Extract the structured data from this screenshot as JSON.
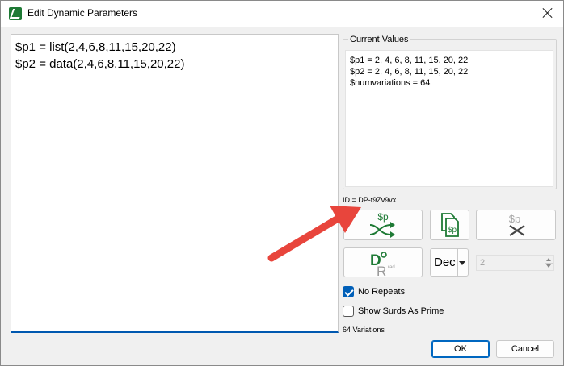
{
  "window": {
    "title": "Edit Dynamic Parameters",
    "app_icon": "spreadsheet-app-icon",
    "close_icon": "close-icon"
  },
  "editor": {
    "lines": [
      "$p1 = list(2,4,6,8,11,15,20,22)",
      "$p2 = data(2,4,6,8,11,15,20,22)"
    ]
  },
  "current_values": {
    "label": "Current Values",
    "lines": [
      "$p1 = 2, 4, 6, 8, 11, 15, 20, 22",
      "$p2 = 2, 4, 6, 8, 11, 15, 20, 22",
      "$numvariations = 64"
    ]
  },
  "id_label": "ID = DP-t9Zv9vx",
  "toolbar": {
    "shuffle_icon": "shuffle-parameters-icon",
    "copy_icon": "copy-parameter-icon",
    "remove_icon": "remove-parameter-icon",
    "remove_label": "$p",
    "shuffle_label": "$p",
    "copy_label": "$p",
    "deg_rad_icon": "degrees-radians-icon",
    "deg_label": "D",
    "rad_label": "R",
    "rad_sub": "rad",
    "dec_label": "Dec",
    "decimals_value": "2"
  },
  "options": {
    "no_repeats_label": "No Repeats",
    "no_repeats_checked": true,
    "show_surds_label": "Show Surds As Prime",
    "show_surds_checked": false
  },
  "variations_label": "64 Variations",
  "buttons": {
    "ok": "OK",
    "cancel": "Cancel"
  },
  "colors": {
    "accent_green": "#1e7a35",
    "annotation_arrow": "#e8453c",
    "focus_blue": "#0067c0"
  }
}
